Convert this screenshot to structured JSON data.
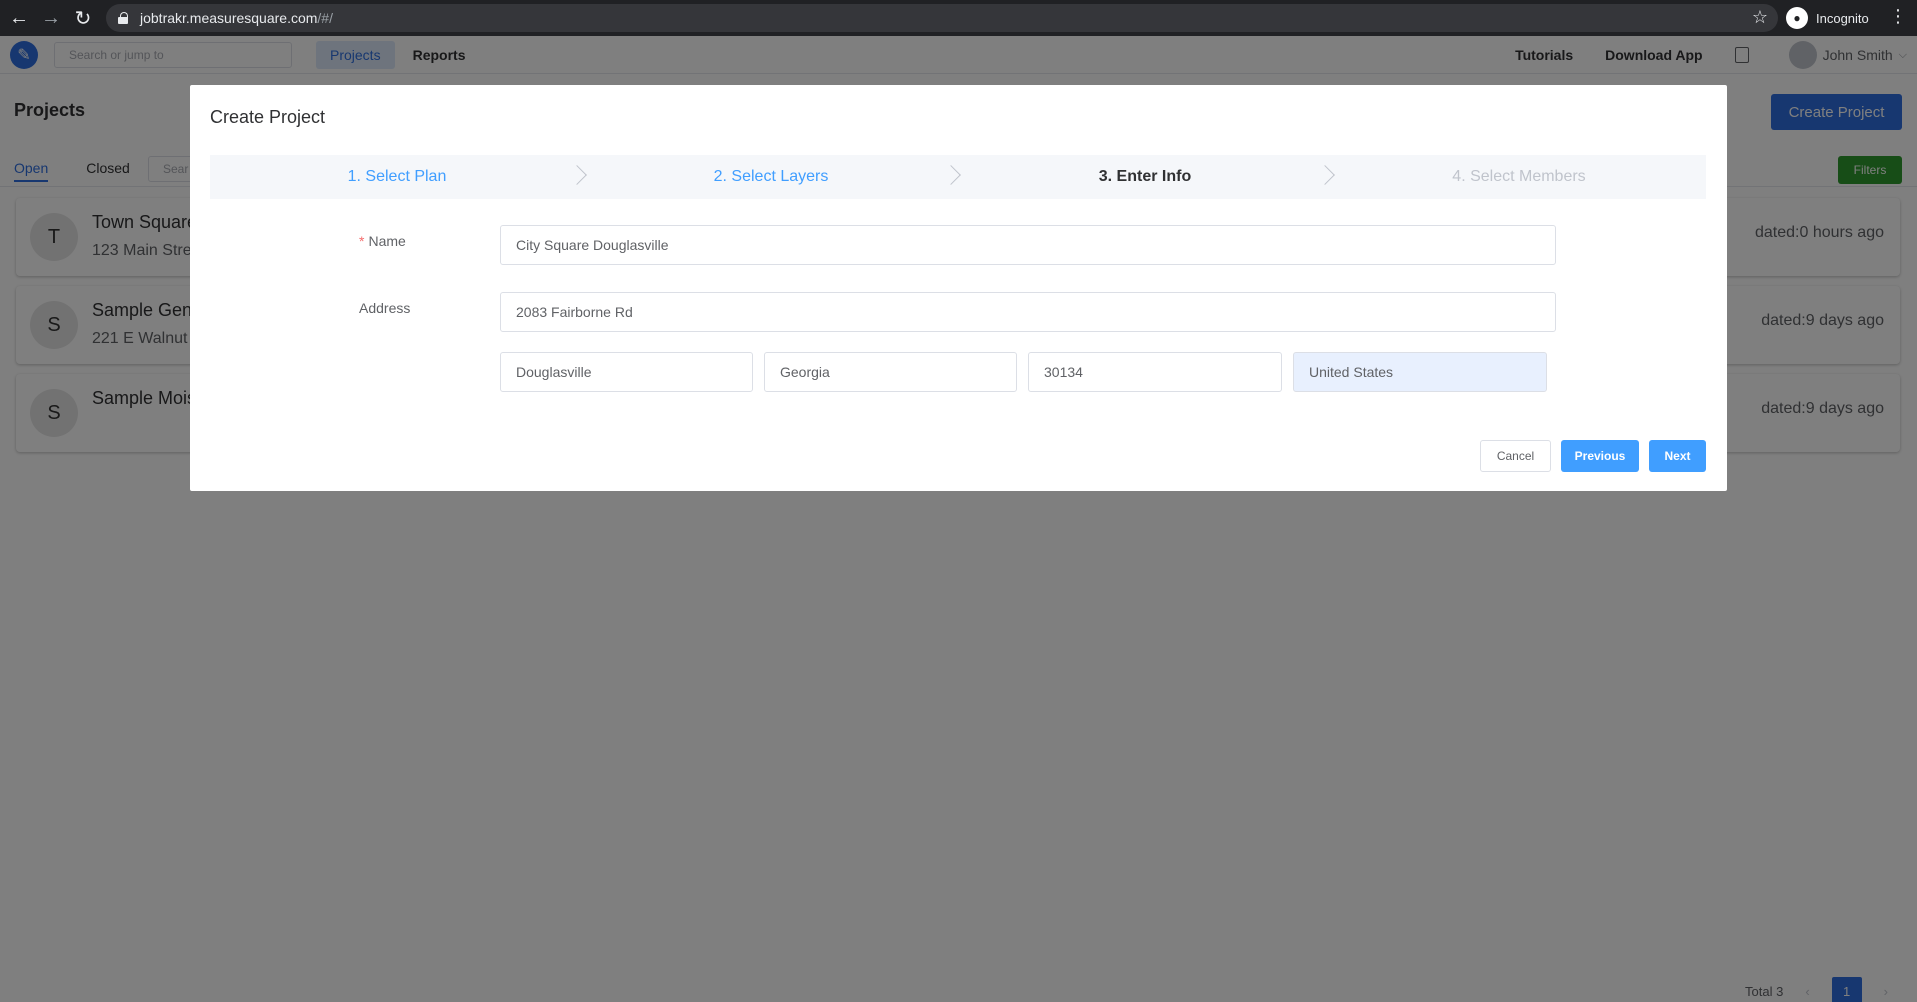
{
  "browser": {
    "url_host": "jobtrakr.measuresquare.com",
    "url_path": "/#/",
    "incognito_label": "Incognito"
  },
  "header": {
    "search_placeholder": "Search or jump to",
    "nav": [
      "Projects",
      "Reports"
    ],
    "links": [
      "Tutorials",
      "Download App"
    ],
    "user_name": "John Smith"
  },
  "page": {
    "title": "Projects",
    "create_button": "Create Project",
    "tabs": [
      "Open",
      "Closed"
    ],
    "search_placeholder": "Sear",
    "filters_button": "Filters",
    "projects": [
      {
        "initial": "T",
        "name": "Town Square",
        "address": "123 Main Stre",
        "updated": "dated:0 hours ago"
      },
      {
        "initial": "S",
        "name": "Sample Gen",
        "address": "221 E Walnut",
        "updated": "dated:9 days ago"
      },
      {
        "initial": "S",
        "name": "Sample Mois",
        "address": "",
        "updated": "dated:9 days ago"
      }
    ],
    "pagination": {
      "total": "Total 3",
      "current": "1"
    }
  },
  "modal": {
    "title": "Create Project",
    "steps": [
      "1. Select Plan",
      "2. Select Layers",
      "3. Enter Info",
      "4. Select Members"
    ],
    "name_label": "Name",
    "name_value": "City Square Douglasville",
    "address_label": "Address",
    "address_value": "2083 Fairborne Rd",
    "city_value": "Douglasville",
    "state_value": "Georgia",
    "zip_value": "30134",
    "country_value": "United States",
    "cancel_label": "Cancel",
    "previous_label": "Previous",
    "next_label": "Next"
  },
  "colors": {
    "primary": "#409eff",
    "brand": "#2f6fe0",
    "filters": "#2e9b2e"
  }
}
